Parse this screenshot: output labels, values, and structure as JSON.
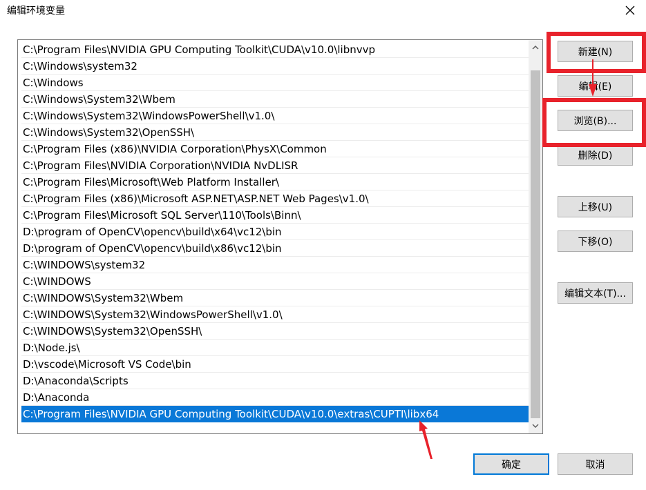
{
  "window": {
    "title": "编辑环境变量"
  },
  "path_list": [
    "C:\\Program Files\\NVIDIA GPU Computing Toolkit\\CUDA\\v10.0\\libnvvp",
    "C:\\Windows\\system32",
    "C:\\Windows",
    "C:\\Windows\\System32\\Wbem",
    "C:\\Windows\\System32\\WindowsPowerShell\\v1.0\\",
    "C:\\Windows\\System32\\OpenSSH\\",
    "C:\\Program Files (x86)\\NVIDIA Corporation\\PhysX\\Common",
    "C:\\Program Files\\NVIDIA Corporation\\NVIDIA NvDLISR",
    "C:\\Program Files\\Microsoft\\Web Platform Installer\\",
    "C:\\Program Files (x86)\\Microsoft ASP.NET\\ASP.NET Web Pages\\v1.0\\",
    "C:\\Program Files\\Microsoft SQL Server\\110\\Tools\\Binn\\",
    "D:\\program of OpenCV\\opencv\\build\\x64\\vc12\\bin",
    "D:\\program of OpenCV\\opencv\\build\\x86\\vc12\\bin",
    "C:\\WINDOWS\\system32",
    "C:\\WINDOWS",
    "C:\\WINDOWS\\System32\\Wbem",
    "C:\\WINDOWS\\System32\\WindowsPowerShell\\v1.0\\",
    "C:\\WINDOWS\\System32\\OpenSSH\\",
    "D:\\Node.js\\",
    "D:\\vscode\\Microsoft VS Code\\bin",
    "D:\\Anaconda\\Scripts",
    "D:\\Anaconda",
    "C:\\Program Files\\NVIDIA GPU Computing Toolkit\\CUDA\\v10.0\\extras\\CUPTI\\libx64"
  ],
  "selected_index": 22,
  "buttons": {
    "new": "新建(N)",
    "edit": "编辑(E)",
    "browse": "浏览(B)...",
    "delete": "删除(D)",
    "move_up": "上移(U)",
    "move_down": "下移(O)",
    "edit_text": "编辑文本(T)...",
    "ok": "确定",
    "cancel": "取消"
  },
  "colors": {
    "selection": "#0a78d7",
    "annotation": "#e8222b"
  },
  "icons": [
    "close-icon",
    "scroll-up-icon",
    "scroll-down-icon",
    "red-arrow-icon"
  ]
}
